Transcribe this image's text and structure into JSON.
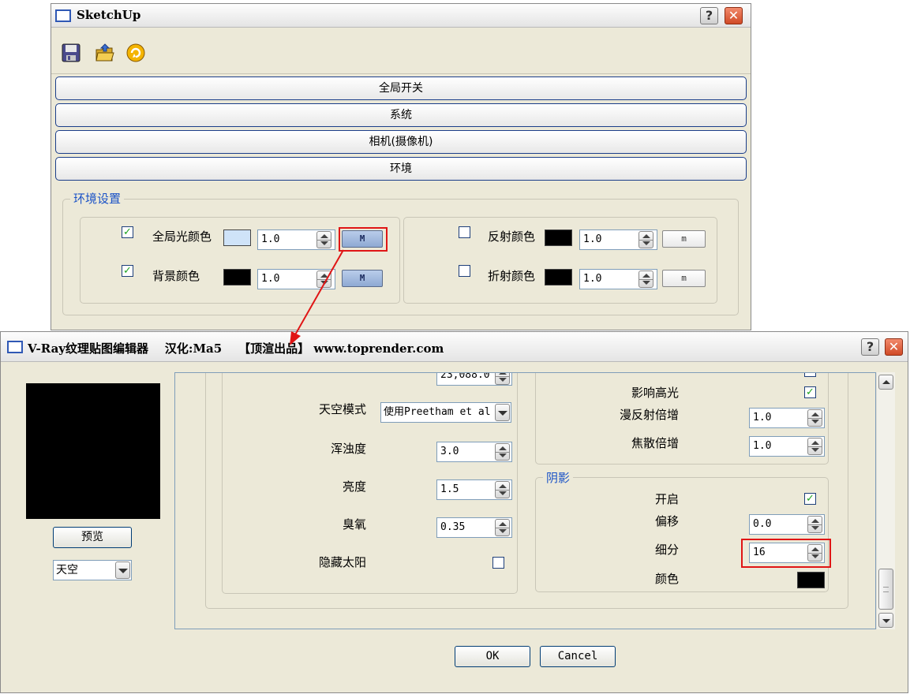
{
  "sketchup": {
    "title": "SketchUp",
    "help_glyph": "?",
    "close_glyph": "✕",
    "toolbar": {
      "icons": [
        "save-icon",
        "open-folder-icon",
        "refresh-icon"
      ]
    },
    "sections": [
      "全局开关",
      "系统",
      "相机(摄像机)",
      "环境"
    ],
    "env_group_title": "环境设置",
    "env_left": [
      {
        "checked": true,
        "label": "全局光颜色",
        "swatch": "#cfe3f8",
        "value": "1.0",
        "map_label": "M",
        "map_active": true
      },
      {
        "checked": true,
        "label": "背景颜色",
        "swatch": "#000000",
        "value": "1.0",
        "map_label": "M",
        "map_active": true
      }
    ],
    "env_right": [
      {
        "checked": false,
        "label": "反射颜色",
        "swatch": "#000000",
        "value": "1.0",
        "map_label": "m",
        "map_active": false
      },
      {
        "checked": false,
        "label": "折射颜色",
        "swatch": "#000000",
        "value": "1.0",
        "map_label": "m",
        "map_active": false
      }
    ],
    "check_glyph": "✓"
  },
  "vray": {
    "title": "V-Ray纹理贴图编辑器    汉化:Ma5    【顶渲出品】 www.toprender.com",
    "help_glyph": "?",
    "close_glyph": "✕",
    "preview_button": "预览",
    "type_select": "天空",
    "sky": {
      "top_value": "23,088.0",
      "mode_label": "天空模式",
      "mode_value": "使用Preetham et al",
      "turbidity_label": "浑浊度",
      "turbidity_value": "3.0",
      "intensity_label": "亮度",
      "intensity_value": "1.5",
      "ozone_label": "臭氧",
      "ozone_value": "0.35",
      "hide_sun_label": "隐藏太阳",
      "hide_sun_checked": false
    },
    "light": {
      "affect_specular_label": "影响高光",
      "affect_specular_checked": true,
      "diffuse_mult_label": "漫反射倍增",
      "diffuse_mult_value": "1.0",
      "caustics_mult_label": "焦散倍增",
      "caustics_mult_value": "1.0"
    },
    "shadow": {
      "group_title": "阴影",
      "on_label": "开启",
      "on_checked": true,
      "bias_label": "偏移",
      "bias_value": "0.0",
      "subdivs_label": "细分",
      "subdivs_value": "16",
      "color_label": "颜色",
      "color_swatch": "#000000"
    },
    "ok_button": "OK",
    "cancel_button": "Cancel"
  }
}
